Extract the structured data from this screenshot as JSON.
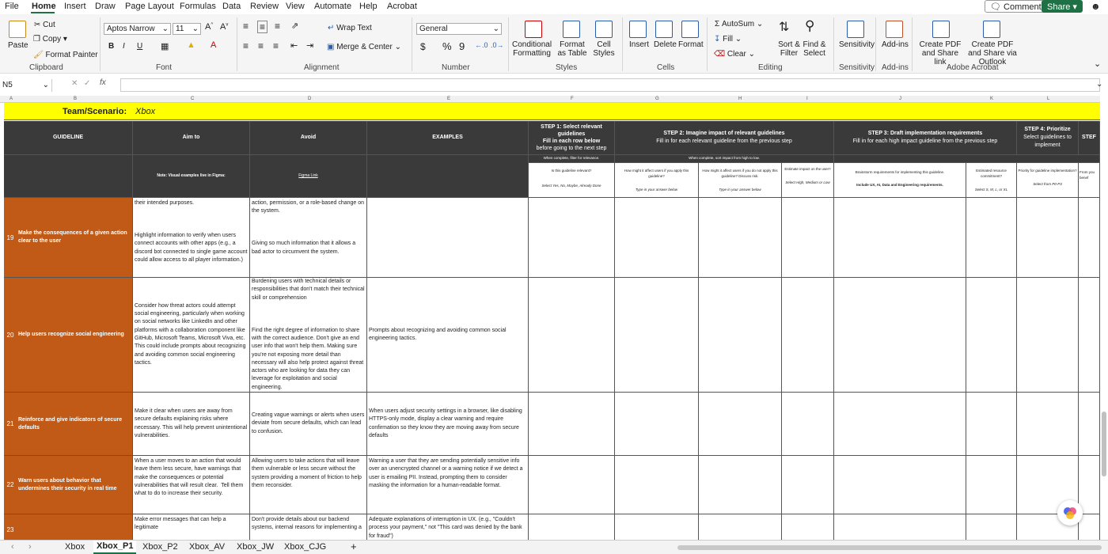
{
  "menu": {
    "tabs": [
      "File",
      "Home",
      "Insert",
      "Draw",
      "Page Layout",
      "Formulas",
      "Data",
      "Review",
      "View",
      "Automate",
      "Help",
      "Acrobat"
    ],
    "comments_label": "Comments",
    "share_label": "Share"
  },
  "ribbon": {
    "clipboard": {
      "paste": "Paste",
      "cut": "Cut",
      "copy": "Copy",
      "format_painter": "Format Painter",
      "label": "Clipboard"
    },
    "font": {
      "name": "Aptos Narrow",
      "size": "11",
      "bold": "B",
      "italic": "I",
      "underline": "U",
      "label": "Font"
    },
    "alignment": {
      "wrap": "Wrap Text",
      "merge": "Merge & Center",
      "label": "Alignment"
    },
    "number": {
      "format": "General",
      "currency": "$",
      "percent": "%",
      "comma": "9",
      "label": "Number"
    },
    "styles": {
      "conditional": "Conditional Formatting",
      "format_table": "Format as Table",
      "cell_styles": "Cell Styles",
      "label": "Styles"
    },
    "cells": {
      "insert": "Insert",
      "delete": "Delete",
      "format": "Format",
      "label": "Cells"
    },
    "editing": {
      "autosum": "AutoSum",
      "fill": "Fill",
      "clear": "Clear",
      "sort": "Sort & Filter",
      "find": "Find & Select",
      "label": "Editing"
    },
    "sensitivity": {
      "btn": "Sensitivity",
      "label": "Sensitivity"
    },
    "addins": {
      "btn": "Add-ins",
      "label": "Add-ins"
    },
    "adobe": {
      "pdf_link": "Create PDF and Share link",
      "pdf_outlook": "Create PDF and Share via Outlook",
      "label": "Adobe Acrobat"
    }
  },
  "formula_bar": {
    "name_box": "N5",
    "fx": "fx",
    "value": ""
  },
  "columns": [
    "A",
    "B",
    "C",
    "D",
    "E",
    "F",
    "G",
    "H",
    "I",
    "J",
    "K",
    "L"
  ],
  "sheet": {
    "team_label": "Team/Scenario:",
    "team_value": "Xbox",
    "headers": {
      "guideline": "GUIDELINE",
      "aim": "Aim to",
      "avoid": "Avoid",
      "examples": "EXAMPLES",
      "step1_title": "STEP 1: Select relevant guidelines",
      "step1_sub1": "Fill in each row below",
      "step1_sub2": "before going to the next step",
      "step2_title": "STEP 2: Imagine impact of relevant guidelines",
      "step2_sub": "Fill in for each relevant guideline from the previous step",
      "step3_title": "STEP 3: Draft implementation requirements",
      "step3_sub": "Fill in for each high impact guideline from the previous step",
      "step4_title": "STEP 4: Prioritize",
      "step4_sub": "Select guidelines to implement",
      "step5_title": "STEF"
    },
    "notes": {
      "step1_note": "When complete, filter for relevance.",
      "step2_note": "When complete, sort impact from high to low.",
      "aim_note": "Note: Visual examples live in Figma:",
      "avoid_note": "Figma Link",
      "f_q": "Is this guideline relevant?",
      "f_sel": "Select Yes, No, Maybe, Already Done",
      "g_q": "How might it affect users if you apply this guideline?",
      "g_sel": "Type in your answer below",
      "h_q": "How might it affect users if you do not apply this guideline? Discuss risk.",
      "h_sel": "Type in your answer below",
      "i_q": "Estimate impact on the user?",
      "i_sel": "Select High, Medium or Low",
      "j_q": "Brainstorm requirements for implementing this guideline.",
      "j_sel": "Include UX, AI, Data and Engineering requirements.",
      "k_q": "Estimated resource commitment?",
      "k_sel": "Select S, M, L, or XL",
      "l_q": "Priority for guideline implementation?",
      "l_sel": "Select from P0-P3",
      "m_q": "From you benef"
    },
    "rows": [
      {
        "num": "19",
        "guideline": "Make the consequences of a given action clear to the user",
        "aim": "their intended purposes.\n\n\n\nHighlight information to verify when users connect accounts with other apps (e.g., a discord bot connected to single game account could allow access to all player information.)",
        "avoid": "action, permission, or a role-based change on the system.\n\n\n\nGiving so much information that it allows a bad actor to circumvent the system.",
        "examples": ""
      },
      {
        "num": "20",
        "guideline": "Help users recognize social engineering",
        "aim": "Consider how threat actors could attempt social engineering, particularly when working on social networks like LinkedIn and other platforms with a collaboration component like GitHub, Microsoft Teams, Microsoft Viva, etc. This could include prompts about recognizing and avoiding common social engineering tactics.",
        "avoid": "Burdening users with technical details or responsibilities that don't match their technical skill or comprehension\n\n\n\nFind the right degree of information to share with the correct audience. Don't give an end user info that won't help them. Making sure you're not exposing more detail than necessary will also help protect against threat actors who are looking for data they can leverage for exploitation and social engineering.",
        "examples": "Prompts about recognizing and avoiding common social engineering tactics."
      },
      {
        "num": "21",
        "guideline": "Reinforce and give indicators of secure defaults",
        "aim": "Make it clear when users are away from secure defaults explaining risks where necessary. This will help prevent unintentional vulnerabilities.",
        "avoid": "Creating vague warnings or alerts when users deviate from secure defaults, which can lead to confusion.",
        "examples": "When users adjust security settings in a browser, like disabling HTTPS-only mode, display a clear warning and require confirmation so they know they are moving away from secure defaults"
      },
      {
        "num": "22",
        "guideline": "Warn users about behavior that undermines their security in real time",
        "aim": "When a user moves to an action that would leave them less secure, have warnings that make the consequences or potential vulnerabilities that will result clear.  Tell them what to do to increase their security.",
        "avoid": "Allowing users to take actions that will leave them vulnerable or less secure without the system providing a moment of friction to help them reconsider.",
        "examples": "Warning a user that they are sending potentially sensitive info over an unencrypted channel or a warning notice if we detect a user is emailing PII. Instead, prompting them to consider masking the information for a human-readable format."
      },
      {
        "num": "23",
        "guideline": "",
        "aim": "Make error messages that can help a legitimate",
        "avoid": "Don't provide details about our backend systems, internal reasons for implementing a",
        "examples": "Adequate explanations of interruption in UX. (e.g., \"Couldn't process your payment,\" not \"This card was denied by the bank for fraud\")"
      }
    ]
  },
  "sheet_tabs": [
    "Xbox",
    "Xbox_P1",
    "Xbox_P2",
    "Xbox_AV",
    "Xbox_JW",
    "Xbox_CJG"
  ],
  "active_tab": "Xbox_P1"
}
